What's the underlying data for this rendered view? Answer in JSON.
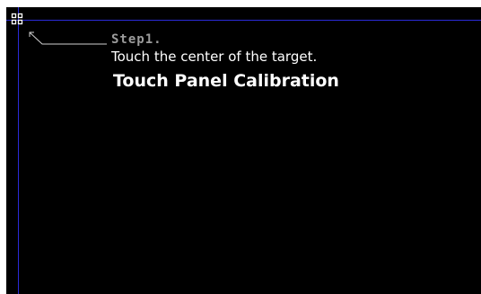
{
  "calibration": {
    "step_label": "Step1.",
    "instruction": "Touch the center of the target.",
    "title": "Touch Panel Calibration"
  },
  "colors": {
    "background": "#000000",
    "crosshair_line": "#2a2ad8",
    "target": "#ffffff",
    "pointer": "#cfcfcf",
    "step_text": "#9c9c9c",
    "text": "#ffffff"
  },
  "icons": {
    "target": "calibration-target-icon",
    "pointer": "pointer-arrow-icon"
  }
}
